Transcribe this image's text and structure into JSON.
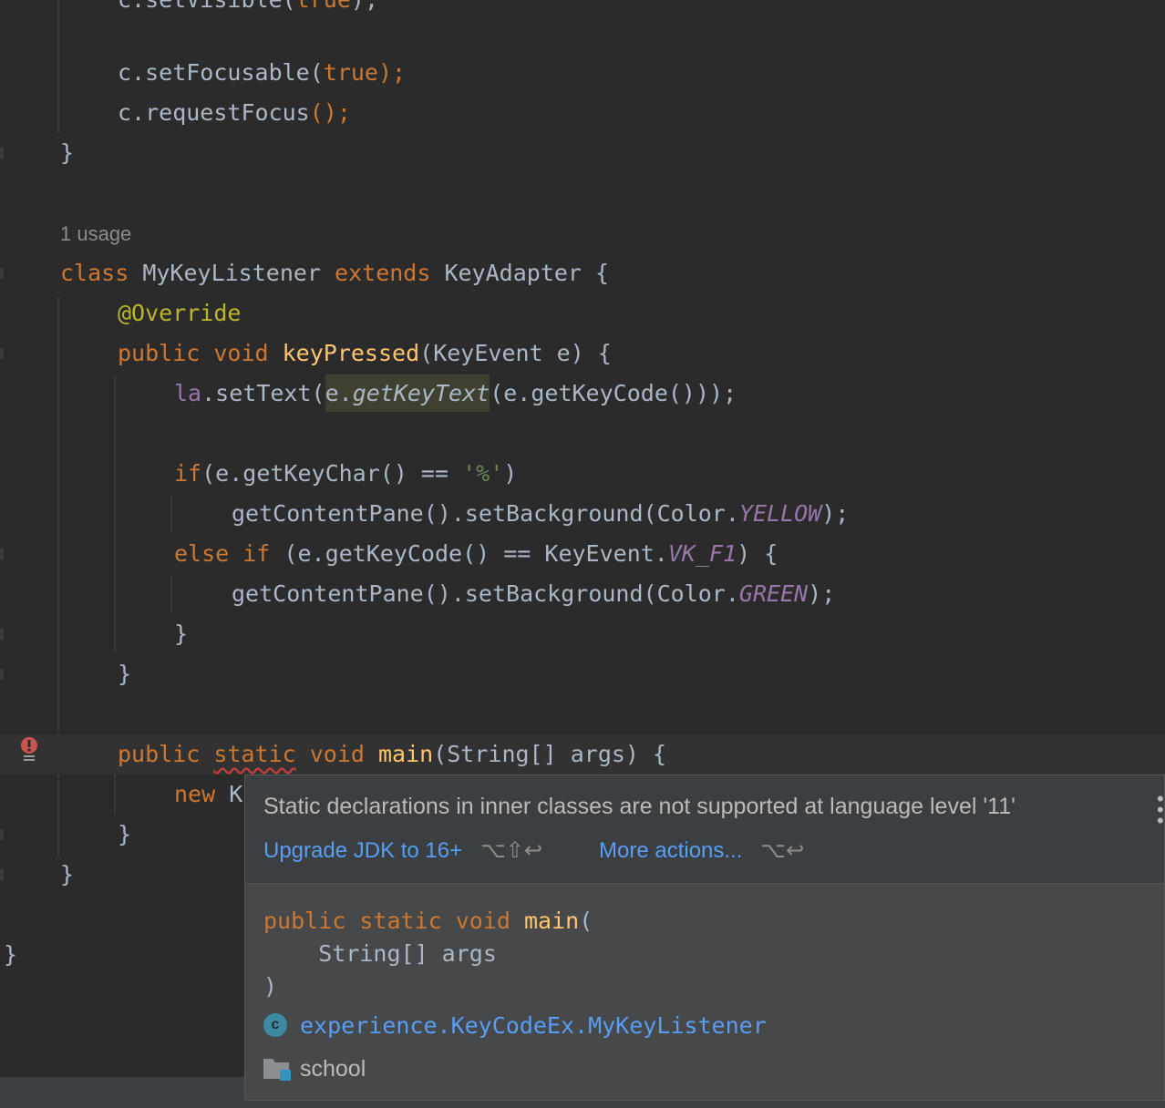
{
  "editor": {
    "usage_hint": "1 usage",
    "lines": {
      "l0": [
        "c.setVisible(",
        "true",
        ");"
      ],
      "l1": [
        "c.setFocusable(",
        "true",
        ");"
      ],
      "l2": [
        "c.requestFocus",
        "();"
      ],
      "l3": "}",
      "l4": [
        "class",
        " MyKeyListener ",
        "extends",
        " KeyAdapter {"
      ],
      "l5": "@Override",
      "l6": [
        "public void ",
        "keyPressed",
        "(KeyEvent e) {"
      ],
      "l7": [
        "la",
        ".setText(",
        "e.",
        "getKeyText",
        "(e.getKeyCode()));"
      ],
      "l8": [
        "if",
        "(e.getKeyChar() == ",
        "'%'",
        ")"
      ],
      "l9": [
        "getContentPane().setBackground(Color.",
        "YELLOW",
        ");"
      ],
      "l10": [
        "else if ",
        "(e.getKeyCode() == KeyEvent.",
        "VK_F1",
        ") {"
      ],
      "l11": [
        "getContentPane().setBackground(Color.",
        "GREEN",
        ");"
      ],
      "l12": "}",
      "l13": "}",
      "l14": [
        "public ",
        "static",
        " void ",
        "main",
        "(String[] args) {"
      ],
      "l15": [
        "new ",
        "K"
      ],
      "l16": "}",
      "l17": "}",
      "l18": "}"
    }
  },
  "popup": {
    "message": "Static declarations in inner classes are not supported at language level '11'",
    "primary_action": "Upgrade JDK to 16+",
    "primary_shortcut": "⌥⇧↩",
    "more_action": "More actions...",
    "more_shortcut": "⌥↩",
    "signature": {
      "line1": [
        "public static void ",
        "main",
        "("
      ],
      "line2": "    String[] args",
      "line3": ")"
    },
    "owner": "experience.KeyCodeEx.MyKeyListener",
    "owner_icon_letter": "c",
    "module": "school"
  },
  "colors": {
    "background": "#2b2b2b",
    "keyword": "#cc7832",
    "function": "#ffc66d",
    "constant": "#9876aa",
    "string": "#6a8759",
    "link": "#589df6",
    "error": "#c75450"
  },
  "icons": [
    "error-icon",
    "class-icon",
    "module-folder-icon",
    "kebab-menu-icon"
  ]
}
